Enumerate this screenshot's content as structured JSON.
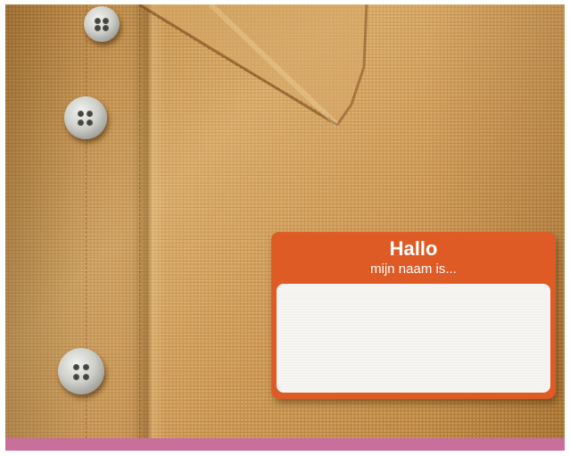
{
  "badge": {
    "greeting": "Hallo",
    "subtitle": "mijn naam is...",
    "accent_color": "#de5b26",
    "field_color": "#f6f5f1"
  },
  "scene": {
    "shirt_color": "#c9954f",
    "button_color": "#cfcfca",
    "footer_band_color": "#c86f9b"
  }
}
